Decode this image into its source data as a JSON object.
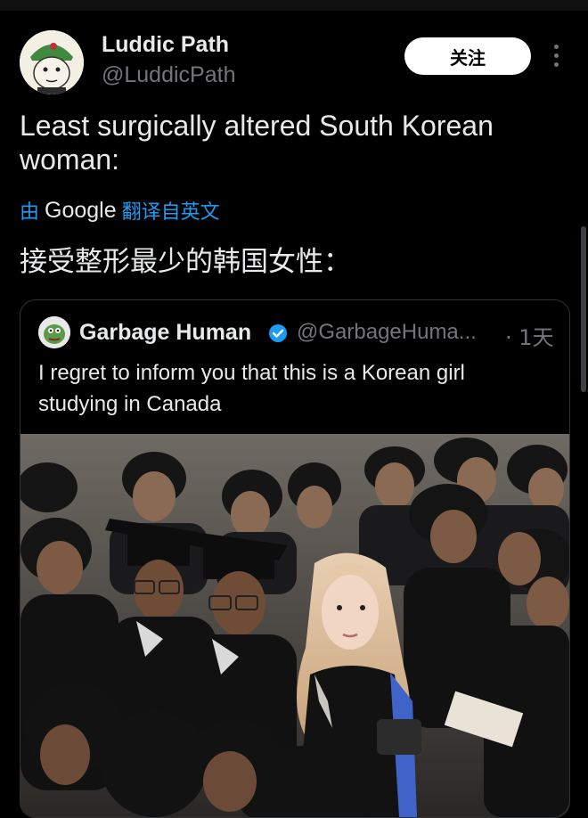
{
  "tweet": {
    "author_name": "Luddic Path",
    "author_handle": "@LuddicPath",
    "follow_label": "关注",
    "text": "Least surgically altered South Korean woman:",
    "translate_prefix": "由",
    "translate_brand": "Google",
    "translate_suffix": "翻译自英文",
    "translated_text": "接受整形最少的韩国女性："
  },
  "quote": {
    "author_name": "Garbage Human",
    "author_handle": "@GarbageHuma...",
    "time": "· 1天",
    "text": "I regret to inform you that this is a Korean girl studying in Canada"
  },
  "icons": {
    "more": "more-options-icon",
    "verified": "verified-badge-icon"
  },
  "colors": {
    "background": "#000000",
    "text": "#e7e9ea",
    "muted": "#71767b",
    "link": "#1d9bf0",
    "verified": "#1d9bf0"
  }
}
